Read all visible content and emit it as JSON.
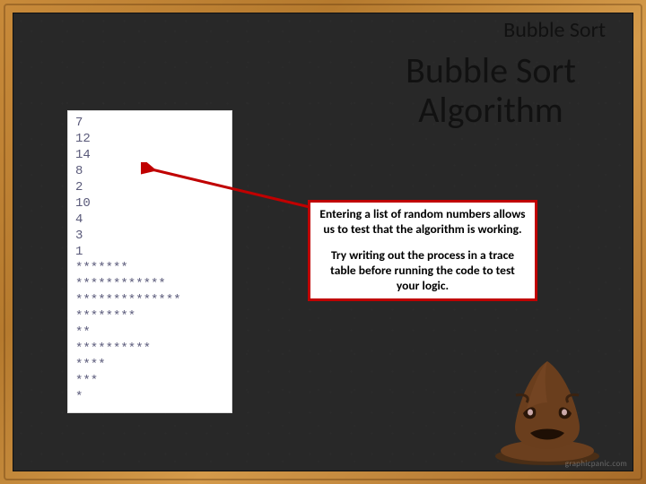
{
  "header": {
    "title": "Bubble Sort"
  },
  "main": {
    "title": "Bubble Sort Algorithm"
  },
  "code": {
    "content": "7\n12\n14\n8\n2\n10\n4\n3\n1\n*******\n************\n**************\n********\n**\n**********\n****\n***\n*"
  },
  "callout": {
    "para1": "Entering a list of random numbers allows us to test that the algorithm is working.",
    "para2": "Try writing out the process in a trace table before running the code to test your logic."
  },
  "watermark": "graphicpanic.com",
  "colors": {
    "accent": "#c00000",
    "arrow": "#c00000",
    "frame": "#b57a2e",
    "board": "#282828"
  },
  "icons": {
    "sorting_hat": "sorting-hat-icon"
  }
}
